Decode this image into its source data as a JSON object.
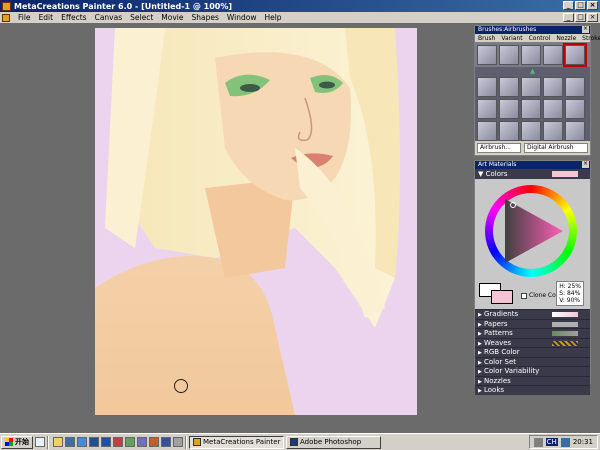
{
  "window": {
    "title": "MetaCreations Painter 6.0 - [Untitled-1 @ 100%]",
    "controls": [
      "_",
      "□",
      "×"
    ]
  },
  "menu": {
    "items": [
      "File",
      "Edit",
      "Effects",
      "Canvas",
      "Select",
      "Movie",
      "Shapes",
      "Window",
      "Help"
    ],
    "doc_controls": [
      "_",
      "□",
      "×"
    ]
  },
  "brushes_palette": {
    "title": "Brushes:Airbrushes",
    "tabs": [
      "Brush",
      "Variant",
      "Control",
      "Nozzle",
      "Stroke"
    ],
    "brush_field": "Airbrush...",
    "variant_field": "Digital Airbrush"
  },
  "art_materials": {
    "title": "Art Materials",
    "colors_label": "Colors",
    "clone_color_label": "Clone Color",
    "hsv": {
      "h": "H: 25%",
      "s": "S: 84%",
      "v": "V: 90%"
    },
    "sections": [
      "Gradients",
      "Papers",
      "Patterns",
      "Weaves",
      "RGB Color",
      "Color Set",
      "Color Variability",
      "Nozzles",
      "Looks"
    ]
  },
  "taskbar": {
    "start_label": "开始",
    "tasks": [
      "MetaCreations Painter 6....",
      "Adobe Photoshop"
    ],
    "ime": "CH",
    "clock": "20:31"
  },
  "colors": {
    "canvas_bg": "#ecd4ee",
    "primary_color": "#ffffff",
    "secondary_color": "#f4c4d4",
    "selected_brush_outline": "#c00000"
  }
}
